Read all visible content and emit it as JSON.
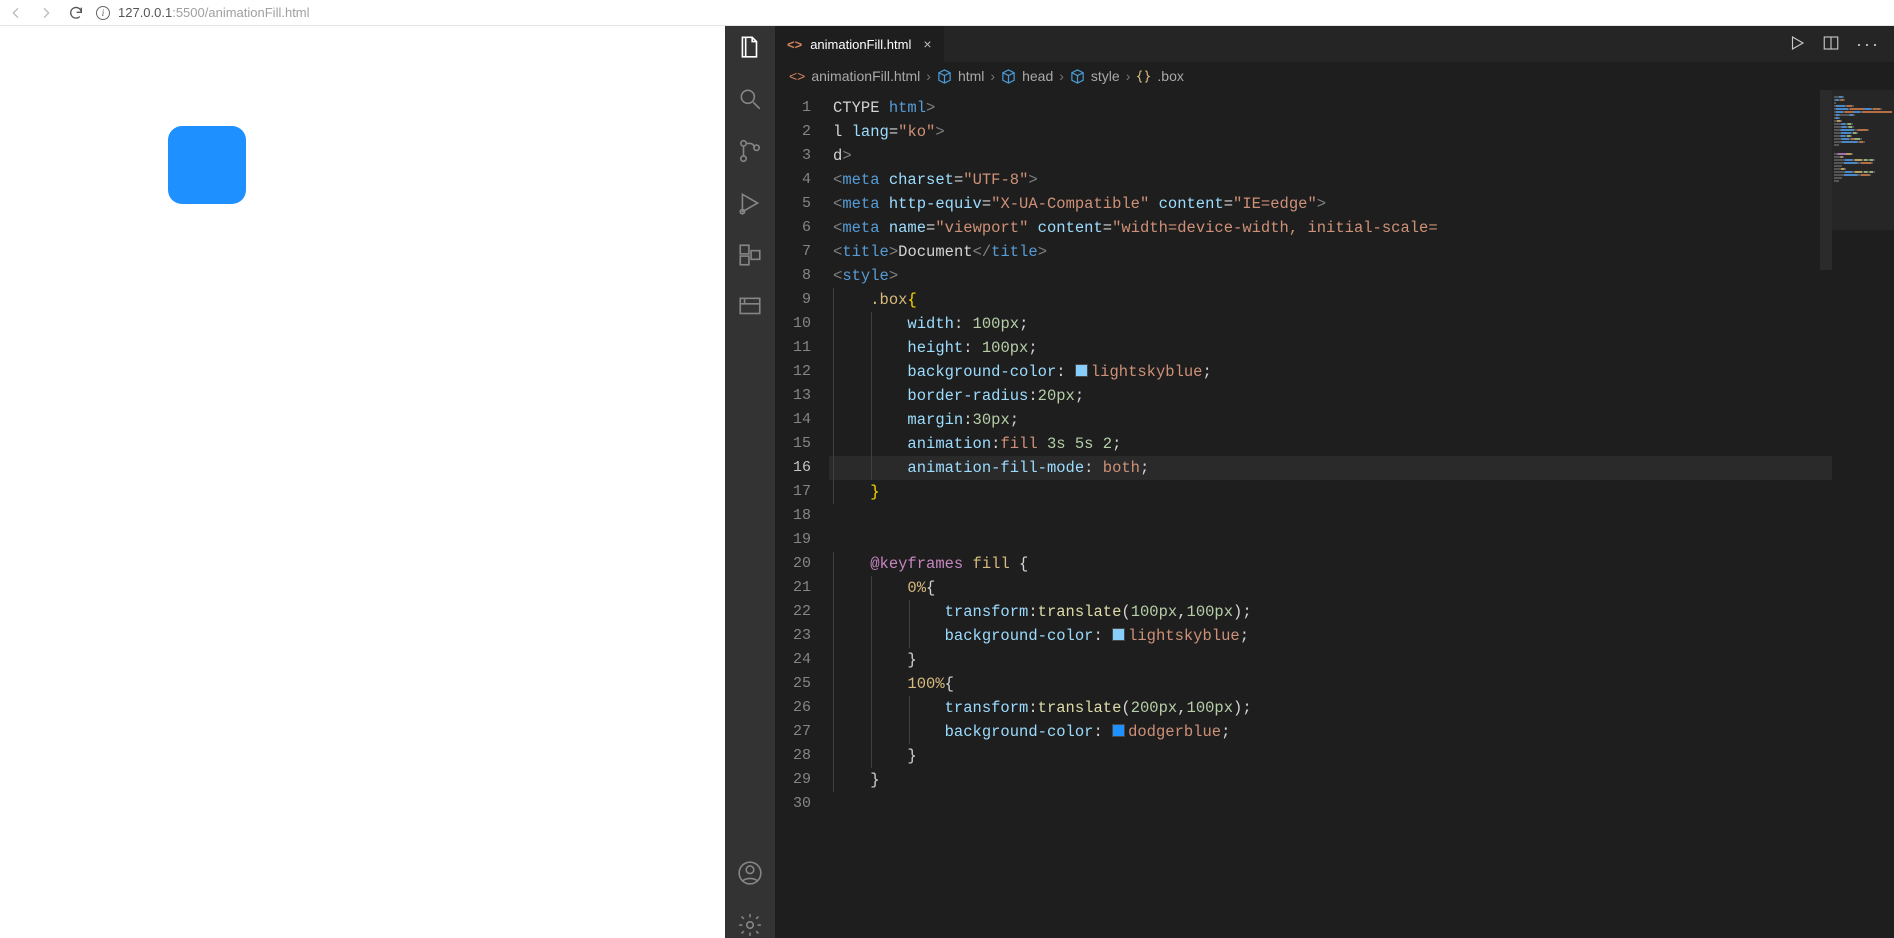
{
  "browser": {
    "url_host": "127.0.0.1",
    "url_port": ":5500",
    "url_path": "/animationFill.html",
    "info_glyph": "i"
  },
  "tab": {
    "filename": "animationFill.html",
    "close_glyph": "×"
  },
  "breadcrumbs": {
    "file": "animationFill.html",
    "seg1": "html",
    "seg2": "head",
    "seg3": "style",
    "seg4": ".box",
    "chevron": "›"
  },
  "gutter_start": 1,
  "gutter_end": 30,
  "current_line": 16,
  "code_lines": [
    [
      {
        "c": "t-text",
        "t": "CTYPE "
      },
      {
        "c": "t-tag",
        "t": "html"
      },
      {
        "c": "t-gray",
        "t": ">"
      }
    ],
    [
      {
        "c": "t-text",
        "t": "l "
      },
      {
        "c": "t-attr",
        "t": "lang"
      },
      {
        "c": "t-text",
        "t": "="
      },
      {
        "c": "t-str",
        "t": "\"ko\""
      },
      {
        "c": "t-gray",
        "t": ">"
      }
    ],
    [
      {
        "c": "t-text",
        "t": "d"
      },
      {
        "c": "t-gray",
        "t": ">"
      }
    ],
    [
      {
        "c": "t-gray",
        "t": "<"
      },
      {
        "c": "t-tag",
        "t": "meta "
      },
      {
        "c": "t-attr",
        "t": "charset"
      },
      {
        "c": "t-text",
        "t": "="
      },
      {
        "c": "t-str",
        "t": "\"UTF-8\""
      },
      {
        "c": "t-gray",
        "t": ">"
      }
    ],
    [
      {
        "c": "t-gray",
        "t": "<"
      },
      {
        "c": "t-tag",
        "t": "meta "
      },
      {
        "c": "t-attr",
        "t": "http-equiv"
      },
      {
        "c": "t-text",
        "t": "="
      },
      {
        "c": "t-str",
        "t": "\"X-UA-Compatible\""
      },
      {
        "c": "t-attr",
        "t": " content"
      },
      {
        "c": "t-text",
        "t": "="
      },
      {
        "c": "t-str",
        "t": "\"IE=edge\""
      },
      {
        "c": "t-gray",
        "t": ">"
      }
    ],
    [
      {
        "c": "t-gray",
        "t": "<"
      },
      {
        "c": "t-tag",
        "t": "meta "
      },
      {
        "c": "t-attr",
        "t": "name"
      },
      {
        "c": "t-text",
        "t": "="
      },
      {
        "c": "t-str",
        "t": "\"viewport\""
      },
      {
        "c": "t-attr",
        "t": " content"
      },
      {
        "c": "t-text",
        "t": "="
      },
      {
        "c": "t-str",
        "t": "\"width=device-width, initial-scale="
      }
    ],
    [
      {
        "c": "t-gray",
        "t": "<"
      },
      {
        "c": "t-tag",
        "t": "title"
      },
      {
        "c": "t-gray",
        "t": ">"
      },
      {
        "c": "t-text",
        "t": "Document"
      },
      {
        "c": "t-gray",
        "t": "</"
      },
      {
        "c": "t-tag",
        "t": "title"
      },
      {
        "c": "t-gray",
        "t": ">"
      }
    ],
    [
      {
        "c": "t-gray",
        "t": "<"
      },
      {
        "c": "t-tag",
        "t": "style"
      },
      {
        "c": "t-gray",
        "t": ">"
      }
    ],
    [
      {
        "c": "",
        "t": "    "
      },
      {
        "c": "t-sel",
        "t": ".box"
      },
      {
        "c": "t-bracket",
        "t": "{"
      }
    ],
    [
      {
        "c": "",
        "t": "        "
      },
      {
        "c": "t-prop",
        "t": "width"
      },
      {
        "c": "t-text",
        "t": ": "
      },
      {
        "c": "t-num",
        "t": "100px"
      },
      {
        "c": "t-text",
        "t": ";"
      }
    ],
    [
      {
        "c": "",
        "t": "        "
      },
      {
        "c": "t-prop",
        "t": "height"
      },
      {
        "c": "t-text",
        "t": ": "
      },
      {
        "c": "t-num",
        "t": "100px"
      },
      {
        "c": "t-text",
        "t": ";"
      }
    ],
    [
      {
        "c": "",
        "t": "        "
      },
      {
        "c": "t-prop",
        "t": "background-color"
      },
      {
        "c": "t-text",
        "t": ": "
      },
      {
        "swatch": "#87cefa"
      },
      {
        "c": "t-val",
        "t": "lightskyblue"
      },
      {
        "c": "t-text",
        "t": ";"
      }
    ],
    [
      {
        "c": "",
        "t": "        "
      },
      {
        "c": "t-prop",
        "t": "border-radius"
      },
      {
        "c": "t-text",
        "t": ":"
      },
      {
        "c": "t-num",
        "t": "20px"
      },
      {
        "c": "t-text",
        "t": ";"
      }
    ],
    [
      {
        "c": "",
        "t": "        "
      },
      {
        "c": "t-prop",
        "t": "margin"
      },
      {
        "c": "t-text",
        "t": ":"
      },
      {
        "c": "t-num",
        "t": "30px"
      },
      {
        "c": "t-text",
        "t": ";"
      }
    ],
    [
      {
        "c": "",
        "t": "        "
      },
      {
        "c": "t-prop",
        "t": "animation"
      },
      {
        "c": "t-text",
        "t": ":"
      },
      {
        "c": "t-val",
        "t": "fill "
      },
      {
        "c": "t-num",
        "t": "3s 5s 2"
      },
      {
        "c": "t-text",
        "t": ";"
      }
    ],
    [
      {
        "c": "",
        "t": "        "
      },
      {
        "c": "t-prop",
        "t": "animation-fill-mode"
      },
      {
        "c": "t-text",
        "t": ": "
      },
      {
        "c": "t-val",
        "t": "both"
      },
      {
        "c": "t-text",
        "t": ";"
      }
    ],
    [
      {
        "c": "",
        "t": "    "
      },
      {
        "c": "t-bracket",
        "t": "}"
      }
    ],
    [
      {
        "c": "",
        "t": ""
      }
    ],
    [
      {
        "c": "",
        "t": ""
      }
    ],
    [
      {
        "c": "",
        "t": "    "
      },
      {
        "c": "t-kw",
        "t": "@keyframes"
      },
      {
        "c": "t-sel",
        "t": " fill "
      },
      {
        "c": "t-brace",
        "t": "{"
      }
    ],
    [
      {
        "c": "",
        "t": "        "
      },
      {
        "c": "t-sel",
        "t": "0%"
      },
      {
        "c": "t-brace",
        "t": "{"
      }
    ],
    [
      {
        "c": "",
        "t": "            "
      },
      {
        "c": "t-prop",
        "t": "transform"
      },
      {
        "c": "t-text",
        "t": ":"
      },
      {
        "c": "t-func",
        "t": "translate"
      },
      {
        "c": "t-text",
        "t": "("
      },
      {
        "c": "t-num",
        "t": "100px"
      },
      {
        "c": "t-text",
        "t": ","
      },
      {
        "c": "t-num",
        "t": "100px"
      },
      {
        "c": "t-text",
        "t": ");"
      }
    ],
    [
      {
        "c": "",
        "t": "            "
      },
      {
        "c": "t-prop",
        "t": "background-color"
      },
      {
        "c": "t-text",
        "t": ": "
      },
      {
        "swatch": "#87cefa"
      },
      {
        "c": "t-val",
        "t": "lightskyblue"
      },
      {
        "c": "t-text",
        "t": ";"
      }
    ],
    [
      {
        "c": "",
        "t": "        "
      },
      {
        "c": "t-brace",
        "t": "}"
      }
    ],
    [
      {
        "c": "",
        "t": "        "
      },
      {
        "c": "t-sel",
        "t": "100%"
      },
      {
        "c": "t-brace",
        "t": "{"
      }
    ],
    [
      {
        "c": "",
        "t": "            "
      },
      {
        "c": "t-prop",
        "t": "transform"
      },
      {
        "c": "t-text",
        "t": ":"
      },
      {
        "c": "t-func",
        "t": "translate"
      },
      {
        "c": "t-text",
        "t": "("
      },
      {
        "c": "t-num",
        "t": "200px"
      },
      {
        "c": "t-text",
        "t": ","
      },
      {
        "c": "t-num",
        "t": "100px"
      },
      {
        "c": "t-text",
        "t": ");"
      }
    ],
    [
      {
        "c": "",
        "t": "            "
      },
      {
        "c": "t-prop",
        "t": "background-color"
      },
      {
        "c": "t-text",
        "t": ": "
      },
      {
        "swatch": "#1e90ff"
      },
      {
        "c": "t-val",
        "t": "dodgerblue"
      },
      {
        "c": "t-text",
        "t": ";"
      }
    ],
    [
      {
        "c": "",
        "t": "        "
      },
      {
        "c": "t-brace",
        "t": "}"
      }
    ],
    [
      {
        "c": "",
        "t": "    "
      },
      {
        "c": "t-brace",
        "t": "}"
      }
    ],
    [
      {
        "c": "",
        "t": ""
      }
    ]
  ]
}
